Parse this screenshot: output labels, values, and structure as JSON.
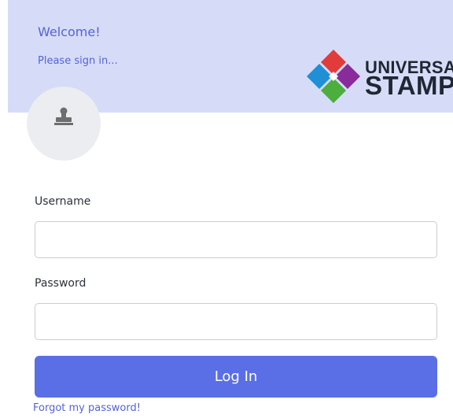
{
  "header": {
    "title": "Welcome!",
    "subtitle": "Please sign in...",
    "logo": {
      "line1": "UNIVERSAL",
      "line2": "STAMP",
      "icon": "universal-stamp-logo-icon"
    }
  },
  "avatar": {
    "icon": "stamp-icon"
  },
  "form": {
    "username_label": "Username",
    "username_value": "",
    "password_label": "Password",
    "password_value": "",
    "login_label": "Log In",
    "forgot_label": "Forgot my password!"
  },
  "colors": {
    "header_bg": "#d6dcf7",
    "accent": "#5a6ee6",
    "link": "#5563d6"
  }
}
